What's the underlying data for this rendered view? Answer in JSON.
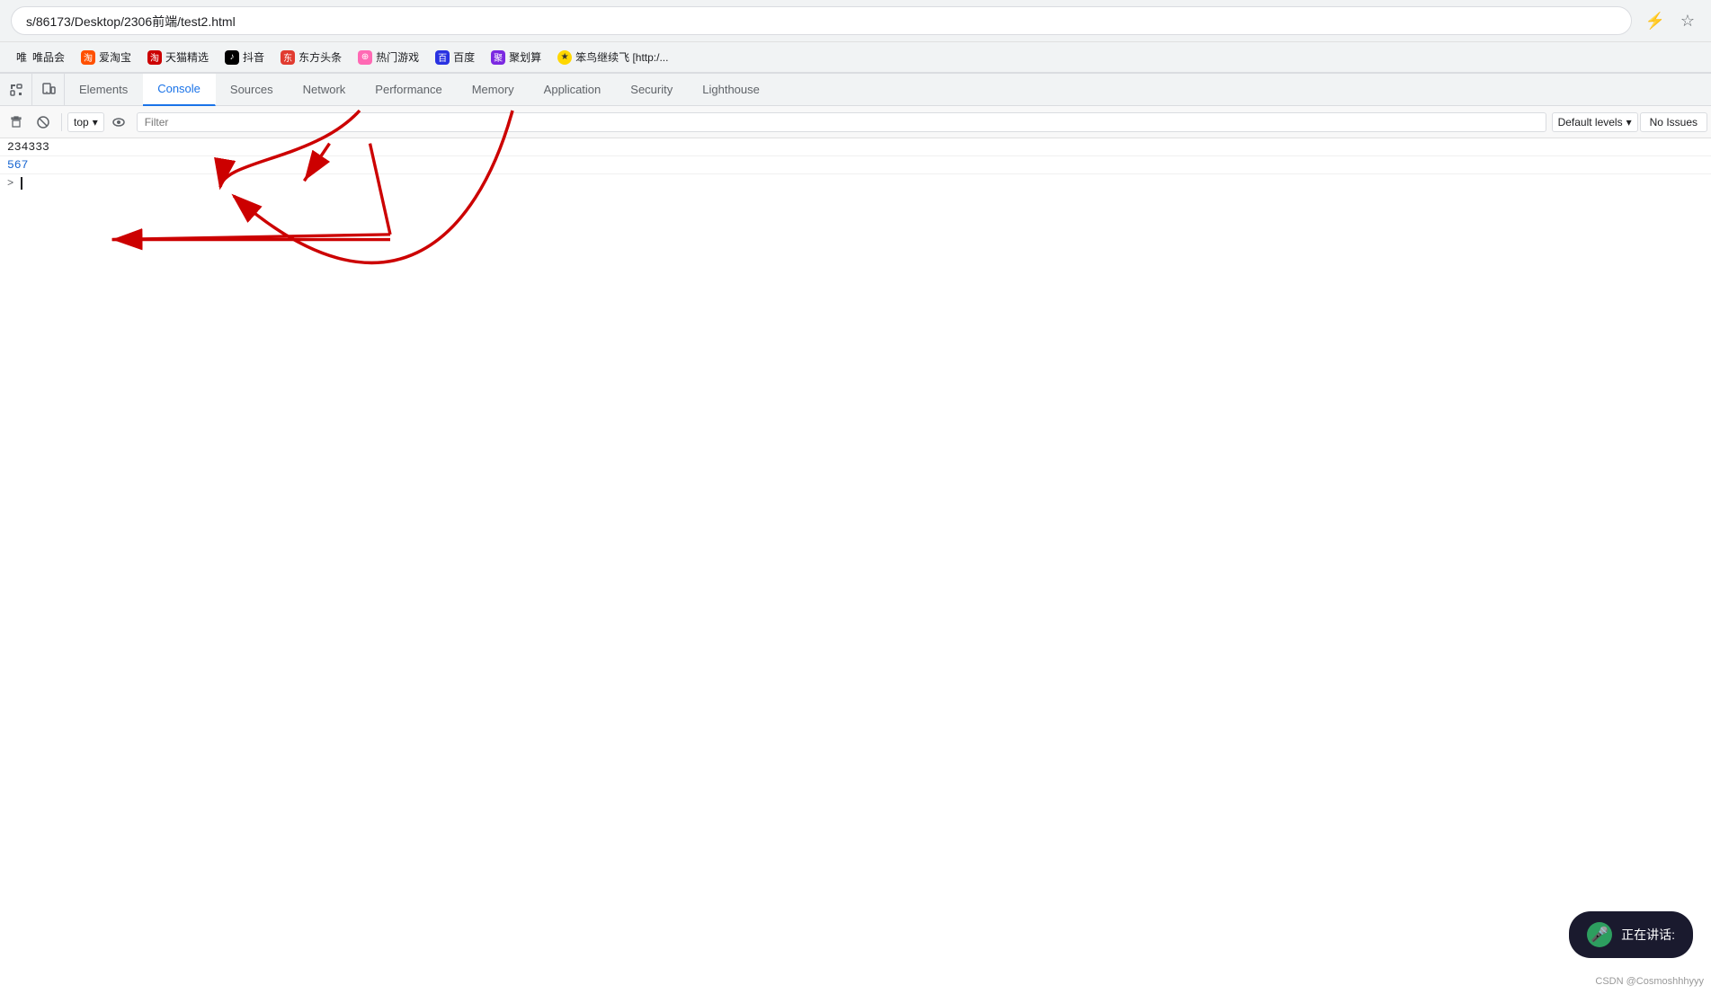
{
  "browser": {
    "address": "s/86173/Desktop/2306前端/test2.html",
    "actions": {
      "lightning": "⚡",
      "star": "☆"
    }
  },
  "bookmarks": [
    {
      "label": "唯品会",
      "icon": "唯",
      "icon_class": ""
    },
    {
      "label": "爱淘宝",
      "icon": "淘",
      "icon_class": "bm-taobao"
    },
    {
      "label": "天猫精选",
      "icon": "淘",
      "icon_class": "bm-tmall"
    },
    {
      "label": "抖音",
      "icon": "♪",
      "icon_class": "bm-tiktok"
    },
    {
      "label": "东方头条",
      "icon": "东",
      "icon_class": "bm-toutiao"
    },
    {
      "label": "热门游戏",
      "icon": "⊕",
      "icon_class": "bm-hot"
    },
    {
      "label": "百度",
      "icon": "百",
      "icon_class": "bm-baidu"
    },
    {
      "label": "聚划算",
      "icon": "聚",
      "icon_class": "bm-juhui"
    },
    {
      "label": "笨鸟继续飞 [http:/...",
      "icon": "★",
      "icon_class": "bm-star"
    }
  ],
  "devtools": {
    "tabs": [
      {
        "id": "elements",
        "label": "Elements",
        "active": false
      },
      {
        "id": "console",
        "label": "Console",
        "active": true
      },
      {
        "id": "sources",
        "label": "Sources",
        "active": false
      },
      {
        "id": "network",
        "label": "Network",
        "active": false
      },
      {
        "id": "performance",
        "label": "Performance",
        "active": false
      },
      {
        "id": "memory",
        "label": "Memory",
        "active": false
      },
      {
        "id": "application",
        "label": "Application",
        "active": false
      },
      {
        "id": "security",
        "label": "Security",
        "active": false
      },
      {
        "id": "lighthouse",
        "label": "Lighthouse",
        "active": false
      }
    ],
    "toolbar": {
      "top_selector": "top",
      "filter_placeholder": "Filter",
      "levels_label": "Default levels",
      "issues_label": "No Issues"
    },
    "console": {
      "lines": [
        {
          "text": "234333",
          "type": "normal"
        },
        {
          "text": "567",
          "type": "blue"
        }
      ],
      "prompt": ">"
    }
  },
  "speaking_widget": {
    "label": "正在讲话:"
  },
  "csdn_credit": "CSDN @Cosmoshhhyyy"
}
